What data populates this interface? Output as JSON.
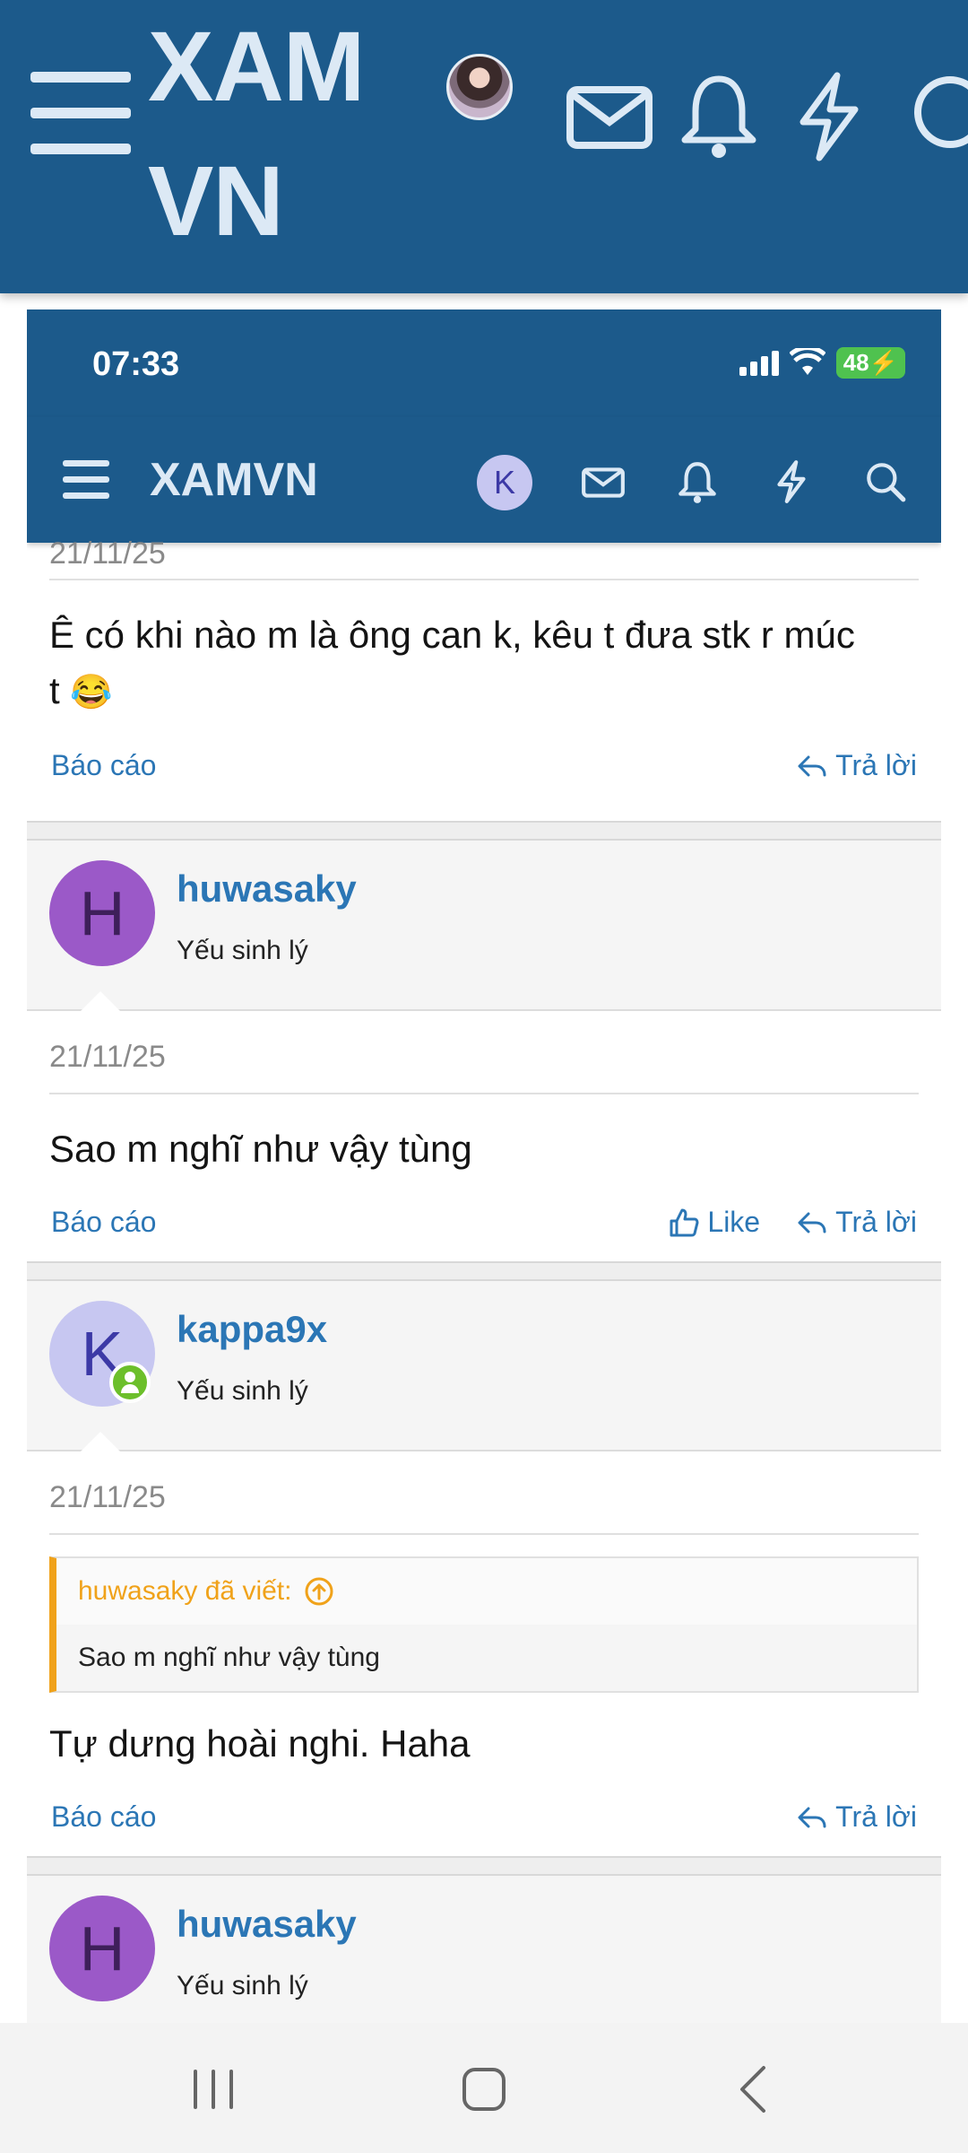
{
  "app_header": {
    "logo": "XAM VN",
    "logo_line1": "XAM",
    "logo_line2": "VN"
  },
  "status_bar": {
    "time": "07:33",
    "battery": "48"
  },
  "nav": {
    "brand": "XAMVN",
    "avatar_letter": "K"
  },
  "posts": [
    {
      "date": "21/11/25",
      "message_line1": "Ê có khi nào m là ông can k, kêu t đưa stk r múc",
      "message_line2": "t",
      "emoji": "😂",
      "report_label": "Báo cáo",
      "reply_label": "Trả lời"
    },
    {
      "username": "huwasaky",
      "avatar_letter": "H",
      "user_title": "Yếu sinh lý",
      "date": "21/11/25",
      "message": "Sao m nghĩ như vậy tùng",
      "report_label": "Báo cáo",
      "like_label": "Like",
      "reply_label": "Trả lời"
    },
    {
      "username": "kappa9x",
      "avatar_letter": "K",
      "user_title": "Yếu sinh lý",
      "date": "21/11/25",
      "quote_author": "huwasaky đã viết:",
      "quote_text": "Sao m nghĩ như vậy tùng",
      "message": "Tự dưng hoài nghi. Haha",
      "report_label": "Báo cáo",
      "reply_label": "Trả lời"
    },
    {
      "username": "huwasaky",
      "avatar_letter": "H",
      "user_title": "Yếu sinh lý"
    }
  ],
  "colors": {
    "header_blue": "#1c5a8b",
    "link_blue": "#2b76b5",
    "quote_orange": "#f0a21a",
    "avatar_purple": "#9b59c8",
    "avatar_lavender": "#c7c7f1",
    "online_green": "#6cbf2b"
  },
  "icons": [
    "menu-icon",
    "mail-icon",
    "bell-icon",
    "bolt-icon",
    "search-icon",
    "reply-icon",
    "like-icon",
    "arrow-up-icon",
    "recent-apps-icon",
    "home-icon",
    "back-icon"
  ]
}
